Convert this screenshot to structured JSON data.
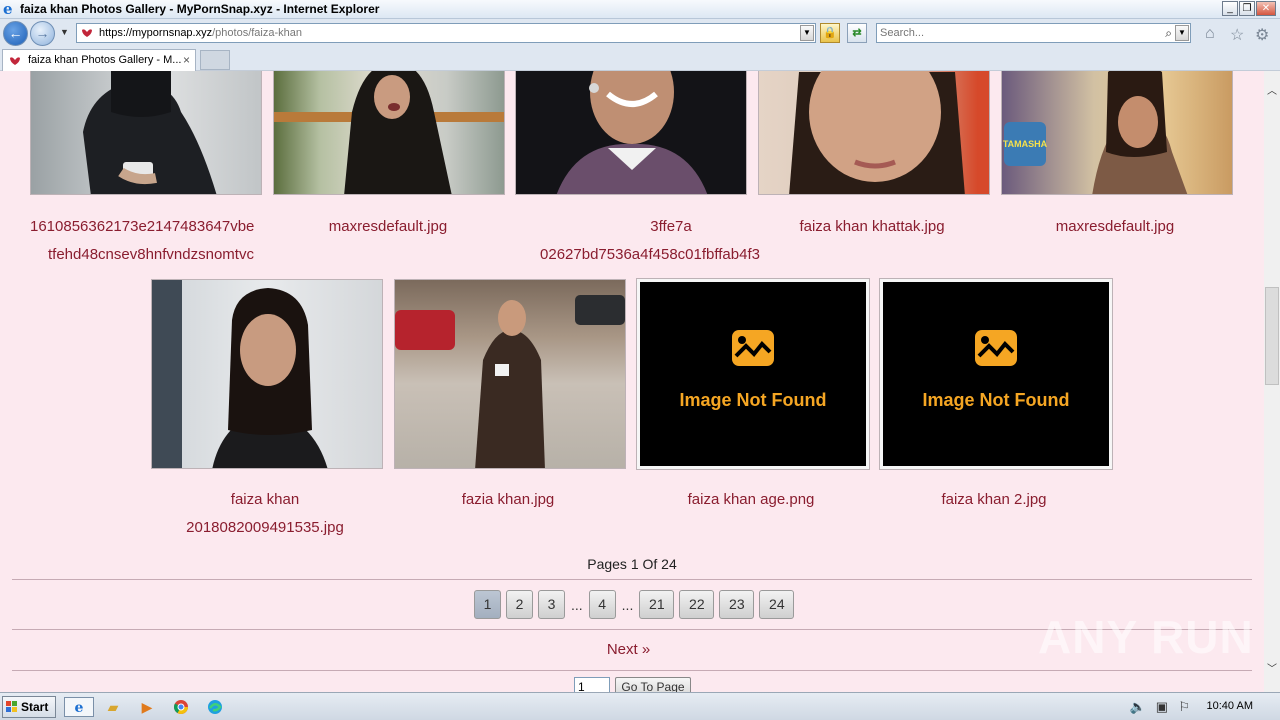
{
  "window": {
    "title": "faiza khan Photos Gallery - MyPornSnap.xyz - Internet Explorer",
    "controls": [
      "_",
      "❐",
      "✕"
    ]
  },
  "nav": {
    "url_host": "https://mypornsnap.xyz",
    "url_path": "/photos/faiza-khan",
    "search_placeholder": "Search..."
  },
  "tab": {
    "label": "faiza khan Photos Gallery - M...",
    "close": "×"
  },
  "gallery": {
    "row1": [
      {
        "caption_line1": "1610856362173e2147483647vbe",
        "caption_line2": "tfehd48cnsev8hnfvndzsnomtvc"
      },
      {
        "caption_line1": "maxresdefault.jpg",
        "caption_line2": ""
      },
      {
        "caption_line1": "3ffe7a",
        "caption_line2": "02627bd7536a4f458c01fbffab4f3"
      },
      {
        "caption_line1": "faiza khan khattak.jpg",
        "caption_line2": ""
      },
      {
        "caption_line1": "maxresdefault.jpg",
        "caption_line2": ""
      }
    ],
    "row2": [
      {
        "caption_line1": "faiza khan",
        "caption_line2": "2018082009491535.jpg"
      },
      {
        "caption_line1": "fazia khan.jpg",
        "caption_line2": ""
      },
      {
        "caption_line1": "faiza khan age.png",
        "caption_line2": "",
        "placeholder_text": "Image Not Found"
      },
      {
        "caption_line1": "faiza khan 2.jpg",
        "caption_line2": "",
        "placeholder_text": "Image Not Found"
      }
    ],
    "thumb_overlay_text": "TAMASHA"
  },
  "pagination": {
    "summary": "Pages 1 Of 24",
    "pages": [
      "1",
      "2",
      "3",
      "4",
      "21",
      "22",
      "23",
      "24"
    ],
    "ellipsis": "...",
    "current": "1",
    "next_label": "Next »",
    "goto_value": "1",
    "goto_button": "Go To Page"
  },
  "watermark": "ANY RUN",
  "taskbar": {
    "start_label": "Start",
    "clock": "10:40 AM"
  },
  "colors": {
    "page_bg": "#fce9ef",
    "link": "#8a1d2f",
    "placeholder_icon": "#f5a623"
  }
}
